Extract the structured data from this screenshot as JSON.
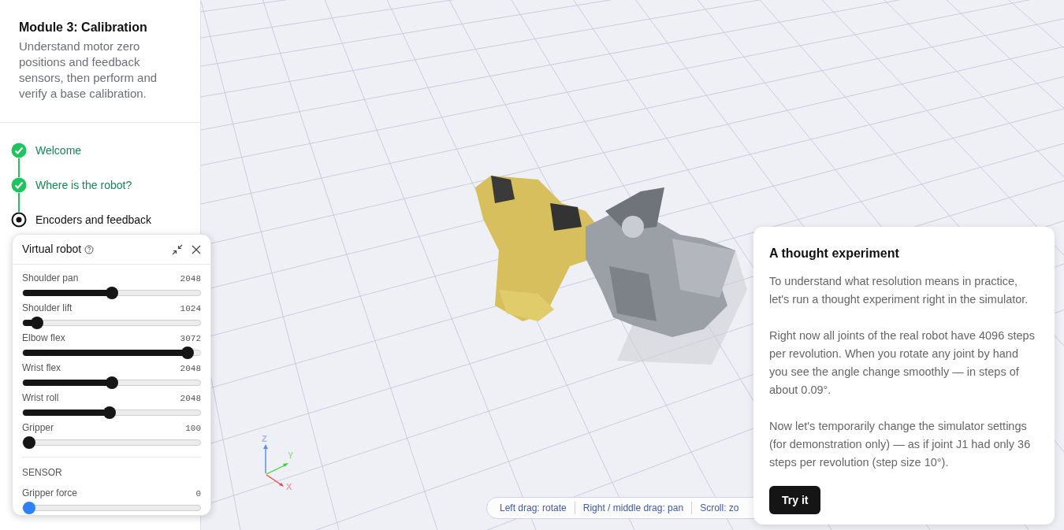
{
  "sidebar": {
    "title": "Module 3: Calibration",
    "description": "Understand motor zero positions and feedback sensors, then perform and verify a base calibration.",
    "steps": [
      {
        "label": "Welcome",
        "completed": true,
        "selected": false
      },
      {
        "label": "Where is the robot?",
        "completed": true,
        "selected": false
      },
      {
        "label": "Encoders and feedback",
        "completed": false,
        "selected": true
      }
    ]
  },
  "robot_panel": {
    "title": "Virtual robot",
    "sliders": [
      {
        "label": "Shoulder pan",
        "reading": "2048",
        "level": 0.5
      },
      {
        "label": "Shoulder lift",
        "reading": "1024",
        "level": 0.08
      },
      {
        "label": "Elbow flex",
        "reading": "3072",
        "level": 0.93
      },
      {
        "label": "Wrist flex",
        "reading": "2048",
        "level": 0.5
      },
      {
        "label": "Wrist roll",
        "reading": "2048",
        "level": 0.49
      },
      {
        "label": "Gripper",
        "reading": "100",
        "level": 0.03
      }
    ],
    "section": "SENSOR",
    "sensors": [
      {
        "label": "Gripper force",
        "reading": "0",
        "level": 0
      }
    ]
  },
  "viewport": {
    "axes": [
      "Z",
      "Y",
      "X"
    ],
    "hints": [
      "Left drag: rotate",
      "Right / middle drag: pan",
      "Scroll: zo"
    ]
  },
  "card": {
    "title": "A thought experiment",
    "paragraphs": [
      "To understand what resolution means in practice, let's run a thought experiment right in the simulator.",
      "Right now all joints of the real robot have 4096 steps per revolution. When you rotate any joint by hand you see the angle change smoothly — in steps of about 0.09°.",
      "Now let's temporarily change the simulator settings (for demonstration only) — as if joint J1 had only 36 steps per revolution (step size 10°)."
    ],
    "button": "Try it"
  }
}
